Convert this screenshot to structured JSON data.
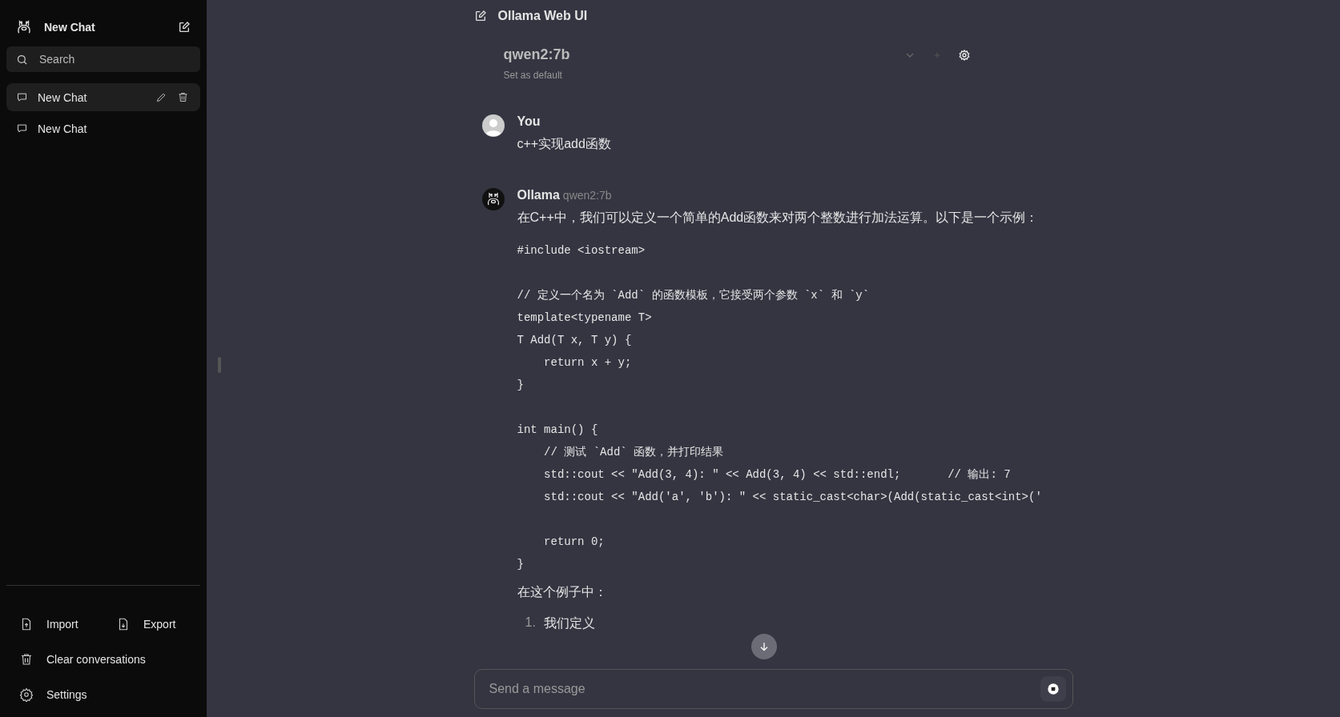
{
  "sidebar": {
    "title": "New Chat",
    "search": {
      "placeholder": "Search"
    },
    "chats": [
      {
        "label": "New Chat",
        "selected": true
      },
      {
        "label": "New Chat",
        "selected": false
      }
    ],
    "actions": [
      {
        "label": "Import",
        "kind": "import"
      },
      {
        "label": "Export",
        "kind": "export"
      }
    ],
    "clear": "Clear conversations",
    "settings": "Settings"
  },
  "header": {
    "title": "Ollama Web UI",
    "model": "qwen2:7b",
    "set_default": "Set as default"
  },
  "messages": [
    {
      "kind": "user",
      "author": "You",
      "text": "c++实现add函数"
    },
    {
      "kind": "assistant",
      "author": "Ollama",
      "model": "qwen2:7b",
      "intro": "在C++中，我们可以定义一个简单的Add函数来对两个整数进行加法运算。以下是一个示例：",
      "code": "#include <iostream>\n\n// 定义一个名为 `Add` 的函数模板，它接受两个参数 `x` 和 `y`\ntemplate<typename T>\nT Add(T x, T y) {\n    return x + y;\n}\n\nint main() {\n    // 测试 `Add` 函数，并打印结果\n    std::cout << \"Add(3, 4): \" << Add(3, 4) << std::endl;       // 输出: 7\n    std::cout << \"Add('a', 'b'): \" << static_cast<char>(Add(static_cast<int>('\n\n    return 0;\n}",
      "after": "在这个例子中：",
      "list": [
        {
          "number": "1.",
          "text": "我们定义"
        }
      ]
    }
  ],
  "composer": {
    "placeholder": "Send a message"
  }
}
